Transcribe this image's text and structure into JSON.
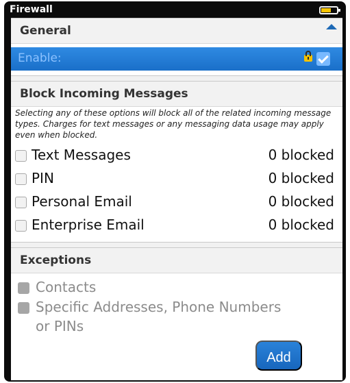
{
  "window": {
    "title": "Firewall"
  },
  "general": {
    "header": "General",
    "enable_label": "Enable:"
  },
  "block": {
    "header": "Block Incoming Messages",
    "description": "Selecting any of these options will block all of the related incoming message types. Charges for text messages or any messaging data usage may apply even when blocked.",
    "items": [
      {
        "label": "Text Messages",
        "count": "0 blocked"
      },
      {
        "label": "PIN",
        "count": "0 blocked"
      },
      {
        "label": "Personal Email",
        "count": "0 blocked"
      },
      {
        "label": "Enterprise Email",
        "count": "0 blocked"
      }
    ]
  },
  "exceptions": {
    "header": "Exceptions",
    "items": [
      {
        "label": "Contacts"
      },
      {
        "label": "Specific Addresses, Phone Numbers"
      },
      {
        "label": "or PINs"
      }
    ],
    "add_label": "Add"
  },
  "icons": {
    "battery": "battery-icon",
    "lock": "lock-icon",
    "checkbox": "checkbox-icon"
  },
  "colors": {
    "accent": "#1a6fc9",
    "highlight": "#78b9ff",
    "battery": "#f6c400"
  }
}
